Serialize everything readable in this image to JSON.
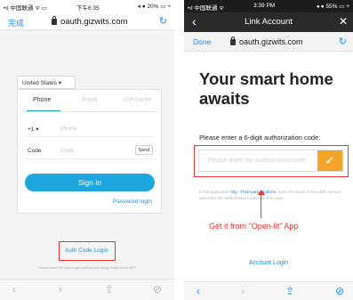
{
  "left": {
    "status": {
      "left": "•ıl 中国联通 ᯤ ▭",
      "time": "下午6:35",
      "right": "◂ ● 20% ▭ +"
    },
    "browser": {
      "done": "完成",
      "url": "oauth.gizwits.com",
      "reload": "↻"
    },
    "country": "United States ▾",
    "tabs": [
      "Phone",
      "Email",
      "Username"
    ],
    "phone_row": {
      "label": "+1 ▾",
      "placeholder": "phone"
    },
    "code_row": {
      "label": "Code",
      "placeholder": "Code",
      "send": "Send"
    },
    "sign_in": "Sign in",
    "password_login": "Password login",
    "auth_code_login": "Auth Code Login",
    "tip": "Please leave the same login method with using Smart Home APP",
    "toolbar": {
      "back": "‹",
      "forward": "›",
      "share": "⇪",
      "compass": "⊘"
    }
  },
  "right": {
    "status": {
      "left": "•ıl 中国联通 ᯤ",
      "time": "3:39 PM",
      "right": "◂ ● 55% ▭ +"
    },
    "nav": {
      "back": "‹",
      "title": "Link Account",
      "close": "✕"
    },
    "browser": {
      "done": "Done",
      "url": "oauth.gizwits.com",
      "reload": "↻"
    },
    "headline": "Your smart home awaits",
    "prompt": "Please enter a 6-digit authorization code:",
    "input_placeholder": "Please enter the authorization code",
    "check": "✓",
    "desc_pre": "In the application ",
    "desc_link": "My - Third-party platform",
    "desc_post": ", open the smart home skills service and enter the authorization code into this page.",
    "annotation": "Get it from \"Open-lit\" App",
    "account_login": "Account Login",
    "toolbar": {
      "back": "‹",
      "forward": "›",
      "share": "⇪",
      "compass": "⊘"
    }
  },
  "colors": {
    "accent": "#1ea6df",
    "annotation": "#e33333",
    "check_button": "#f5a42b",
    "nav_bar": "#2a2a2a"
  }
}
